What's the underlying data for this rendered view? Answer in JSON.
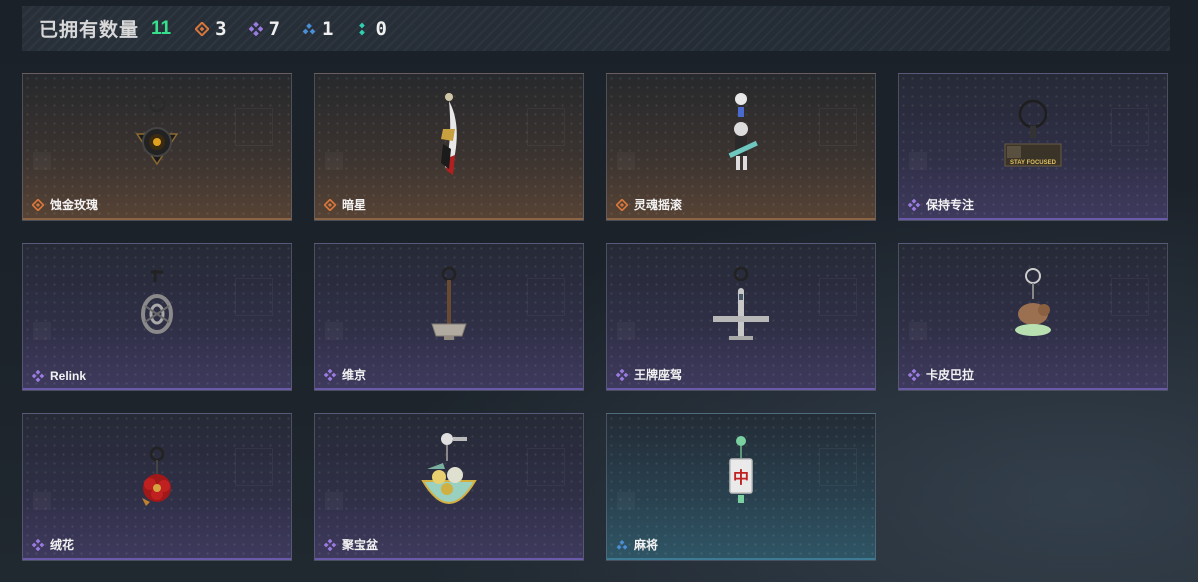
{
  "header": {
    "title": "已拥有数量",
    "total": "11",
    "stats": [
      {
        "rarity": "orange",
        "count": "3"
      },
      {
        "rarity": "purple",
        "count": "7"
      },
      {
        "rarity": "blue",
        "count": "1"
      },
      {
        "rarity": "teal",
        "count": "0"
      }
    ]
  },
  "colors": {
    "orange": "#d9773a",
    "purple": "#9a7be0",
    "blue": "#4a8fd6",
    "teal": "#2fcfb0",
    "total": "#37e08a"
  },
  "items": [
    {
      "name": "蚀金玫瑰",
      "rarity": "orange",
      "icon": "black-gold-rose-charm-icon"
    },
    {
      "name": "暗星",
      "rarity": "orange",
      "icon": "dark-star-blade-charm-icon"
    },
    {
      "name": "灵魂摇滚",
      "rarity": "orange",
      "icon": "skeleton-guitarist-charm-icon"
    },
    {
      "name": "保持专注",
      "rarity": "purple",
      "icon": "stay-focused-tag-charm-icon"
    },
    {
      "name": "Relink",
      "rarity": "purple",
      "icon": "relink-knot-charm-icon"
    },
    {
      "name": "维京",
      "rarity": "purple",
      "icon": "viking-hammer-charm-icon"
    },
    {
      "name": "王牌座驾",
      "rarity": "purple",
      "icon": "fighter-jet-charm-icon"
    },
    {
      "name": "卡皮巴拉",
      "rarity": "purple",
      "icon": "capybara-charm-icon"
    },
    {
      "name": "绒花",
      "rarity": "purple",
      "icon": "red-flower-charm-icon"
    },
    {
      "name": "聚宝盆",
      "rarity": "purple",
      "icon": "treasure-bowl-charm-icon"
    },
    {
      "name": "麻将",
      "rarity": "blue",
      "icon": "mahjong-tile-charm-icon"
    }
  ],
  "item_stamp": {
    "text": "STAY FOCUSED"
  },
  "mahjong_glyph": "中"
}
